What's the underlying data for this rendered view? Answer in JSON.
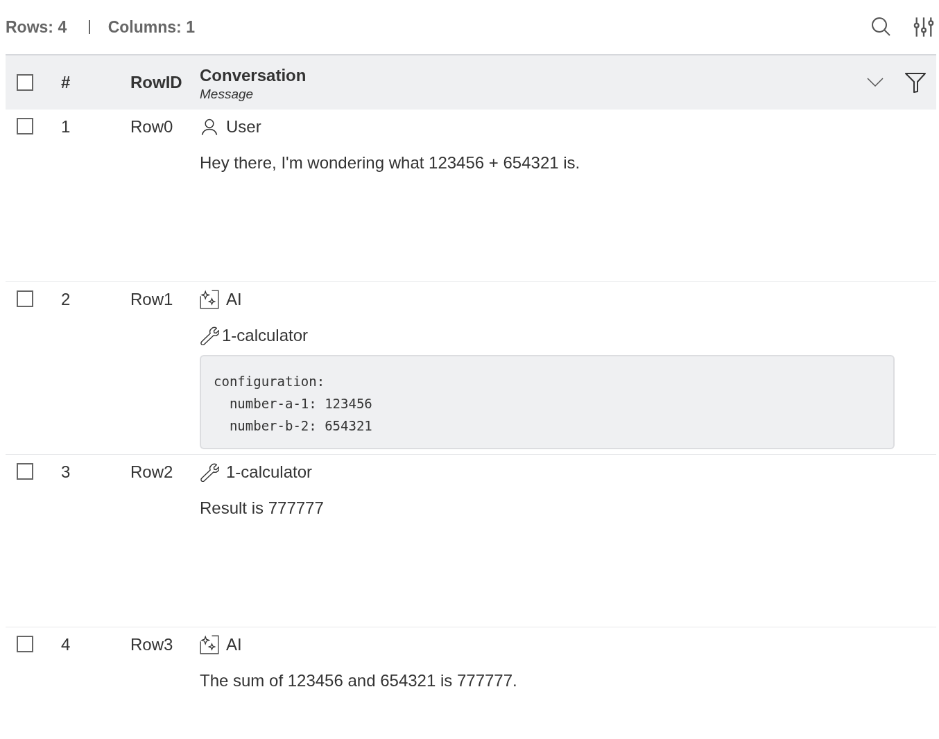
{
  "toolbar": {
    "rows": "Rows: 4",
    "columns": "Columns: 1"
  },
  "header": {
    "selected": false,
    "number": "#",
    "row_id": "RowID",
    "column": {
      "title": "Conversation",
      "subtitle": "Message"
    }
  },
  "rows": [
    {
      "selected": false,
      "number": "1",
      "row_id": "Row0",
      "message": {
        "kind": "user",
        "role": "User",
        "text": "Hey there, I'm wondering what 123456 + 654321 is."
      }
    },
    {
      "selected": false,
      "number": "2",
      "row_id": "Row1",
      "message": {
        "kind": "ai",
        "role": "AI",
        "tool_call": {
          "name": "1-calculator",
          "code": [
            "configuration:",
            "  number-a-1: 123456",
            "  number-b-2: 654321"
          ]
        }
      }
    },
    {
      "selected": false,
      "number": "3",
      "row_id": "Row2",
      "message": {
        "kind": "tool",
        "role": "1-calculator",
        "text": "Result is 777777"
      }
    },
    {
      "selected": false,
      "number": "4",
      "row_id": "Row3",
      "message": {
        "kind": "ai",
        "role": "AI",
        "text": "The sum of 123456 and 654321 is 777777."
      }
    }
  ]
}
